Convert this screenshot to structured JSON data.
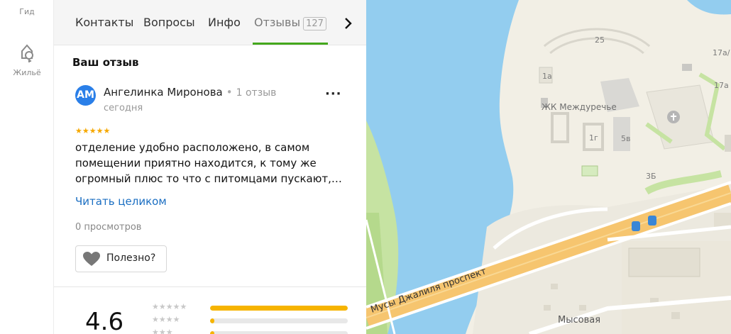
{
  "rail": {
    "guide_label": "Гид",
    "housing_label": "Жильё"
  },
  "tabs": {
    "contacts": "Контакты",
    "questions": "Вопросы",
    "info": "Инфо",
    "reviews": "Отзывы",
    "reviews_count": "127",
    "more_icon": "chevron-right-icon"
  },
  "review": {
    "section_title": "Ваш отзыв",
    "avatar_initials": "АМ",
    "author": "Ангелинка Миронова",
    "author_reviews": "1 отзыв",
    "date": "сегодня",
    "rating": 5,
    "text": "отделение удобно расположено, в самом помещении приятно находится, к тому же огромный плюс то что с питомцами пускают,…",
    "read_more": "Читать целиком",
    "views": "0 просмотров",
    "helpful_label": "Полезно?",
    "accent_color": "#44a81d",
    "avatar_color": "#2a7fe8"
  },
  "rating_summary": {
    "value": "4.6",
    "distribution": [
      {
        "stars": 5,
        "share": 1.0
      },
      {
        "stars": 4,
        "share": 0.03
      },
      {
        "stars": 3,
        "share": 0.03
      }
    ]
  },
  "map": {
    "labels": {
      "residential": "ЖК Междуречье",
      "avenue": "Мусы Джалиля проспект",
      "street": "Мысовая",
      "bld_25": "25",
      "bld_1a": "1а",
      "bld_1g": "1г",
      "bld_5v": "5в",
      "bld_3b": "3Б",
      "bld_17a_top": "17а/",
      "bld_17a": "17а"
    },
    "colors": {
      "water": "#93cdef",
      "land": "#f2efe5",
      "park": "#c6e3a2",
      "road": "#f6c56f"
    }
  }
}
